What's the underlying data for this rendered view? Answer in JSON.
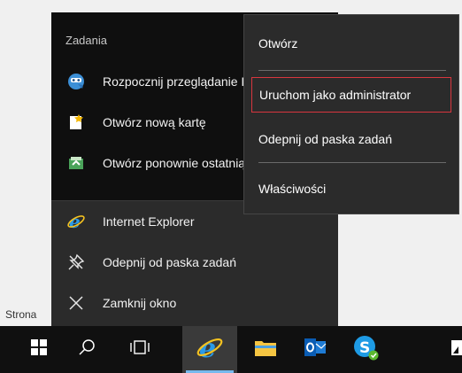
{
  "desktop": {
    "status_text": "Strona"
  },
  "jumplist": {
    "section_title": "Zadania",
    "tasks": [
      {
        "label": "Rozpocznij przeglądanie InPrivate",
        "icon": "inprivate-icon"
      },
      {
        "label": "Otwórz nową kartę",
        "icon": "new-tab-icon"
      },
      {
        "label": "Otwórz ponownie ostatnią sesję",
        "icon": "reopen-session-icon"
      }
    ],
    "pinned": [
      {
        "label": "Internet Explorer",
        "icon": "internet-explorer-icon"
      },
      {
        "label": "Odepnij od paska zadań",
        "icon": "unpin-icon"
      },
      {
        "label": "Zamknij okno",
        "icon": "close-icon"
      }
    ]
  },
  "context_menu": {
    "items": [
      {
        "label": "Otwórz"
      },
      {
        "label": "Uruchom jako administrator",
        "highlighted": true
      },
      {
        "label": "Odepnij od paska zadań"
      },
      {
        "label": "Właściwości"
      }
    ],
    "highlight_color": "#d9363e"
  },
  "taskbar": {
    "buttons": [
      {
        "name": "start-button",
        "icon": "windows-logo-icon"
      },
      {
        "name": "search-button",
        "icon": "search-icon"
      },
      {
        "name": "task-view-button",
        "icon": "task-view-icon"
      },
      {
        "name": "internet-explorer-taskbar-button",
        "icon": "internet-explorer-icon",
        "active": true
      },
      {
        "name": "file-explorer-button",
        "icon": "folder-icon"
      },
      {
        "name": "outlook-button",
        "icon": "outlook-icon"
      },
      {
        "name": "skype-button",
        "icon": "skype-icon"
      },
      {
        "name": "partial-app-button",
        "icon": "app-icon"
      }
    ],
    "accent_color": "#76b9ed"
  }
}
